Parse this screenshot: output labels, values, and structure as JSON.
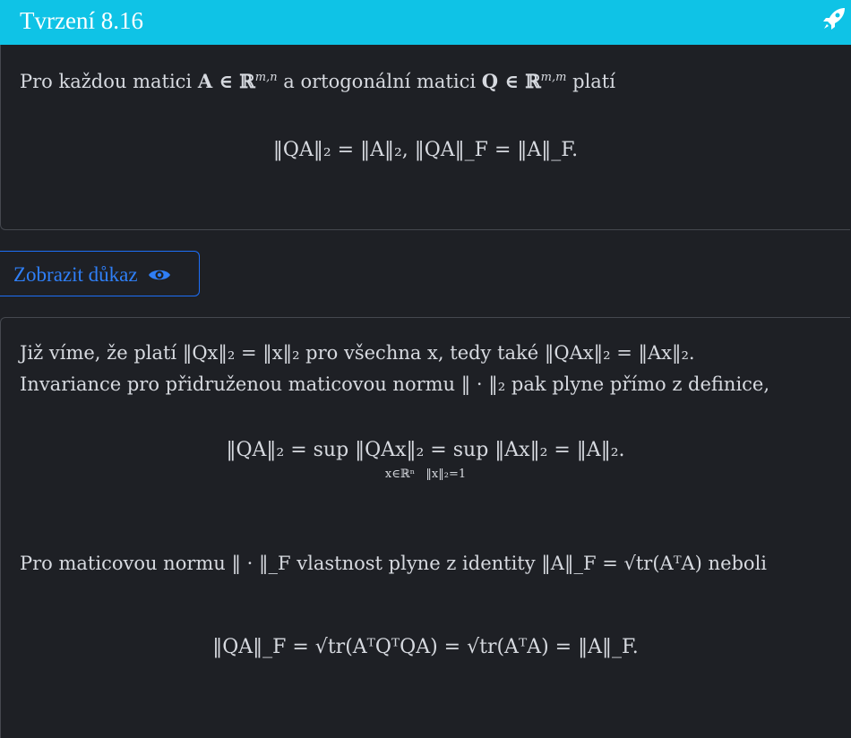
{
  "header": {
    "title": "Tvrzení 8.16",
    "icon": "rocket-icon"
  },
  "statement": {
    "intro_a": "Pro každou matici ",
    "intro_b": " a ortogonální matici ",
    "intro_c": " platí",
    "A_set": "A ∈ ℝ",
    "A_sup": "m,n",
    "Q_set": "Q ∈ ℝ",
    "Q_sup": "m,m",
    "formula": "‖QA‖₂ = ‖A‖₂,   ‖QA‖_F = ‖A‖_F."
  },
  "proof_button": {
    "label": "Zobrazit důkaz",
    "icon": "eye-icon"
  },
  "proof": {
    "line1": "Již víme, že platí ‖Qx‖₂ = ‖x‖₂ pro všechna x, tedy také ‖QAx‖₂ = ‖Ax‖₂.",
    "line2": "Invariance pro přidruženou maticovou normu ‖ · ‖₂ pak plyne přímo z definice,",
    "eq1": "‖QA‖₂ = sup ‖QAx‖₂ = sup ‖Ax‖₂ = ‖A‖₂.",
    "sup_limit_1": "x∈ℝⁿ",
    "sup_limit_2": "‖x‖₂=1",
    "line3": "Pro maticovou normu ‖ · ‖_F vlastnost plyne z identity ‖A‖_F = √tr(AᵀA) neboli",
    "eq2": "‖QA‖_F = √tr(AᵀQᵀQA) = √tr(AᵀA) = ‖A‖_F."
  },
  "colors": {
    "header": "#0fc3e6",
    "background": "#1e2025",
    "button": "#1d6ef7"
  }
}
